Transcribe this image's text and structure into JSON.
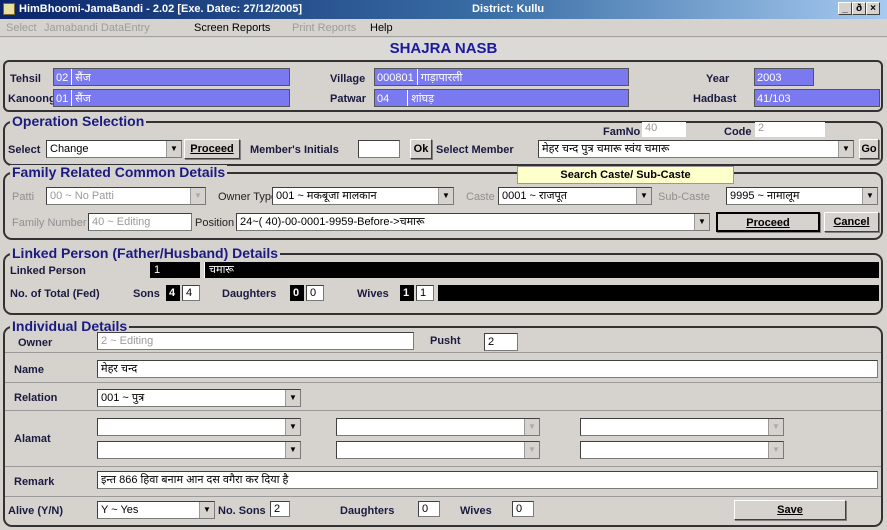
{
  "window": {
    "title": "HimBhoomi-JamaBandi - 2.02 [Exe. Datec: 27/12/2005]",
    "district": "District: Kullu",
    "controls": "_ | 6 | ×"
  },
  "menu": [
    "Select",
    "Jamabandi DataEntry",
    "Screen Reports",
    "Print Reports",
    "Help"
  ],
  "page_title": "SHAJRA  NASB",
  "location": {
    "tehsil_label": "Tehsil",
    "tehsil_code": "02",
    "tehsil_name": "सैंज",
    "kanoongo_label": "Kanoongo",
    "kanoongo_code": "01",
    "kanoongo_name": "सैंज",
    "village_label": "Village",
    "village_code": "000801",
    "village_name": "गाड़ापारली",
    "patwar_label": "Patwar",
    "patwar_code": "04",
    "patwar_name": "शांघड़",
    "year_label": "Year",
    "year_value": "2003",
    "hadbast_label": "Hadbast",
    "hadbast_value": "41/103"
  },
  "operation": {
    "legend": "Operation Selection",
    "select_label": "Select",
    "select_value": "Change",
    "proceed_label": "Proceed",
    "member_initials_label": "Member's Initials",
    "member_initials_value": "",
    "ok_label": "Ok",
    "select_member_label": "Select Member",
    "select_member_value": "मेहर चन्द पुत्र चमारू स्वंय चमारू",
    "famno_label": "FamNo",
    "famno_value": "40",
    "code_label": "Code",
    "code_value": "2",
    "go_label": "Go"
  },
  "family": {
    "legend": "Family Related Common Details",
    "search_caste_label": "Search Caste/ Sub-Caste",
    "patti_label": "Patti",
    "patti_value": "00 ~ No Patti",
    "owner_type_label": "Owner Type",
    "owner_type_value": "001 ~ मकबूजा मालकान",
    "caste_label": "Caste",
    "caste_value": "0001 ~ राजपूत",
    "subcaste_label": "Sub-Caste",
    "subcaste_value": "9995 ~ नामालूम",
    "family_number_label": "Family Number",
    "family_number_value": "40 ~ Editing",
    "position_label": "Position",
    "position_value": "24~(  40)-00-0001-9959-Before->चमारू",
    "proceed_label": "Proceed",
    "cancel_label": "Cancel"
  },
  "linked": {
    "legend": "Linked Person (Father/Husband) Details",
    "linked_person_label": "Linked Person",
    "linked_person_num": "1",
    "linked_person_name": "चमारू",
    "total_fed_label": "No. of Total (Fed)",
    "sons_label": "Sons",
    "sons_black": "4",
    "sons_value": "4",
    "daughters_label": "Daughters",
    "daughters_black": "0",
    "daughters_value": "0",
    "wives_label": "Wives",
    "wives_black": "1",
    "wives_value": "1"
  },
  "individual": {
    "legend": "Individual Details",
    "owner_label": "Owner",
    "owner_value": "2 ~ Editing",
    "pusht_label": "Pusht",
    "pusht_value": "2",
    "name_label": "Name",
    "name_value": "मेहर चन्द",
    "relation_label": "Relation",
    "relation_value": "001 ~ पुत्र",
    "alamat_label": "Alamat",
    "remark_label": "Remark",
    "remark_value": "इन्त 866 हिवा बनाम आन दस वगैरा कर दिया है",
    "alive_label": "Alive (Y/N)",
    "alive_value": "Y ~ Yes",
    "no_sons_label": "No. Sons",
    "no_sons_value": "2",
    "daughters_label": "Daughters",
    "daughters_value": "0",
    "wives_label": "Wives",
    "wives_value": "0",
    "save_label": "Save"
  }
}
